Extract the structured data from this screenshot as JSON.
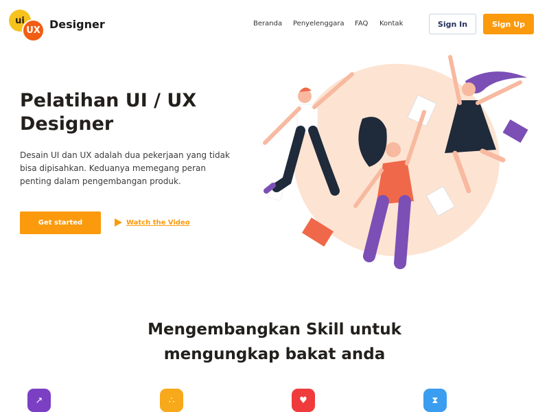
{
  "header": {
    "logo": {
      "badge_small": "ui",
      "badge_large": "UX"
    },
    "brand": "Designer",
    "nav": [
      "Beranda",
      "Penyelenggara",
      "FAQ",
      "Kontak"
    ],
    "sign_in": "Sign In",
    "sign_up": "Sign Up"
  },
  "hero": {
    "title": "Pelatihan UI / UX Designer",
    "description": "Desain UI dan UX adalah dua pekerjaan yang tidak bisa dipisahkan. Keduanya memegang peran penting dalam pengembangan produk.",
    "cta_label": "Get started",
    "video_label": "Watch the Video"
  },
  "section": {
    "title": "Mengembangkan Skill untuk mengungkap bakat anda"
  },
  "features": [
    {
      "icon": "cursor-icon",
      "glyph": "↗",
      "color": "#7b3fc4"
    },
    {
      "icon": "share-icon",
      "glyph": "∴",
      "color": "#f8a81b"
    },
    {
      "icon": "heart-icon",
      "glyph": "♥",
      "color": "#ef3b3b"
    },
    {
      "icon": "hourglass-icon",
      "glyph": "⧗",
      "color": "#3a9df0"
    }
  ],
  "colors": {
    "accent": "#fb9a0d",
    "text_dark": "#23201c",
    "blob": "#fde3d2"
  }
}
